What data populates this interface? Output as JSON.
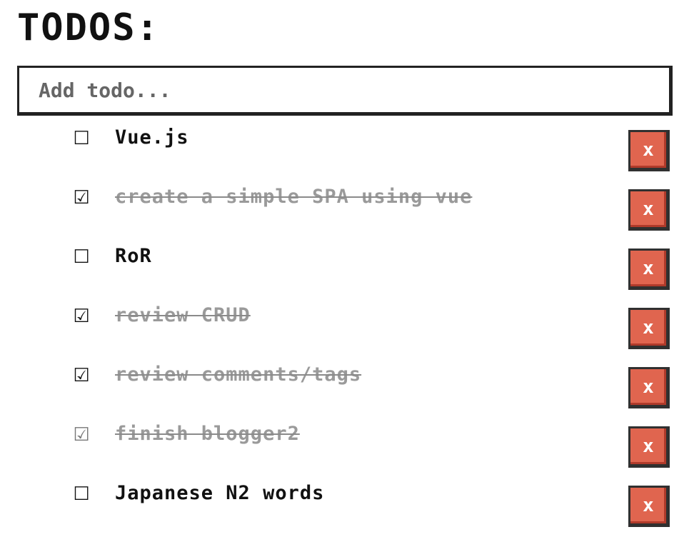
{
  "header": {
    "title": "TODOS:"
  },
  "add_todo": {
    "placeholder": "Add todo...",
    "value": ""
  },
  "check_glyphs": {
    "unchecked": "☐",
    "checked": "☑"
  },
  "todos": [
    {
      "text": "Vue.js",
      "done": false
    },
    {
      "text": "create a simple SPA using vue",
      "done": true
    },
    {
      "text": "RoR",
      "done": false
    },
    {
      "text": "review CRUD",
      "done": true
    },
    {
      "text": "review comments/tags",
      "done": true
    },
    {
      "text": "finish blogger2",
      "done": true
    },
    {
      "text": "Japanese N2 words",
      "done": false
    }
  ],
  "delete_button": {
    "label": "x"
  },
  "colors": {
    "delete_bg": "#e0654f",
    "done_text": "#9a9a9a",
    "text": "#111111"
  }
}
